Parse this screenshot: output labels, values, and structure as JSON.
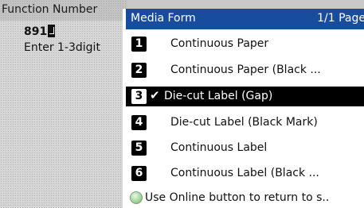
{
  "background": {
    "header_title": "Function Number",
    "entered_value": "891",
    "hint": "Enter 1-3digit"
  },
  "popup": {
    "title": "Media Form",
    "page_indicator": "1/1 Page",
    "items": [
      {
        "number": "1",
        "label": "Continuous Paper",
        "selected": false
      },
      {
        "number": "2",
        "label": "Continuous Paper (Black ...",
        "selected": false
      },
      {
        "number": "3",
        "label": "Die-cut Label (Gap)",
        "selected": true
      },
      {
        "number": "4",
        "label": "Die-cut Label (Black Mark)",
        "selected": false
      },
      {
        "number": "5",
        "label": "Continuous Label",
        "selected": false
      },
      {
        "number": "6",
        "label": "Continuous Label (Black ...",
        "selected": false
      }
    ],
    "check_glyph": "✔",
    "footer_text": "Use Online button to return to s.."
  },
  "colors": {
    "header_blue": "#184c9c",
    "selected_bg": "#000000",
    "online_button": "#9fd39a"
  }
}
